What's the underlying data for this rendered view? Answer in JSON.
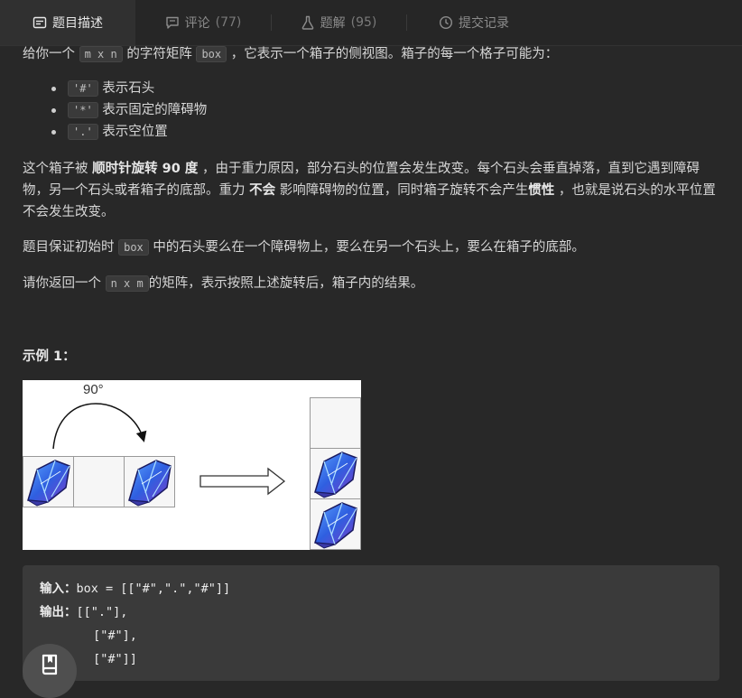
{
  "tabs": [
    {
      "label": "题目描述",
      "icon": "description-icon",
      "count": ""
    },
    {
      "label": "评论",
      "icon": "comment-icon",
      "count": "(77)"
    },
    {
      "label": "题解",
      "icon": "flask-icon",
      "count": "(95)"
    },
    {
      "label": "提交记录",
      "icon": "clock-icon",
      "count": ""
    }
  ],
  "intro": {
    "t1": "给你一个 ",
    "c1": "m x n",
    "t2": " 的字符矩阵 ",
    "c2": "box",
    "t3": " ，它表示一个箱子的侧视图。箱子的每一个格子可能为："
  },
  "cells": [
    {
      "code": "'#'",
      "desc": "表示石头"
    },
    {
      "code": "'*'",
      "desc": "表示固定的障碍物"
    },
    {
      "code": "'.'",
      "desc": "表示空位置"
    }
  ],
  "rotation": {
    "t1": "这个箱子被 ",
    "b1": "顺时针旋转 90 度",
    "t2": " ，由于重力原因，部分石头的位置会发生改变。每个石头会垂直掉落，直到它遇到障碍物，另一个石头或者箱子的底部。重力 ",
    "b2": "不会",
    "t3": " 影响障碍物的位置，同时箱子旋转不会产生",
    "b3": "惯性",
    "t4": " ，也就是说石头的水平位置不会发生改变。"
  },
  "guarantee": {
    "t1": "题目保证初始时 ",
    "c1": "box",
    "t2": " 中的石头要么在一个障碍物上，要么在另一个石头上，要么在箱子的底部。"
  },
  "ret": {
    "t1": "请你返回一个 ",
    "c1": "n x m",
    "t2": "的矩阵，表示按照上述旋转后，箱子内的结果。"
  },
  "example": {
    "heading": "示例 1：",
    "figure_label": "90°",
    "input_label": "输入：",
    "input_value": "box = [[\"#\",\".\",\"#\"]]",
    "output_label": "输出：",
    "output_lines": [
      "[[\".\"],",
      " [\"#\"],",
      " [\"#\"]]"
    ]
  },
  "fab_icon": "book-icon"
}
